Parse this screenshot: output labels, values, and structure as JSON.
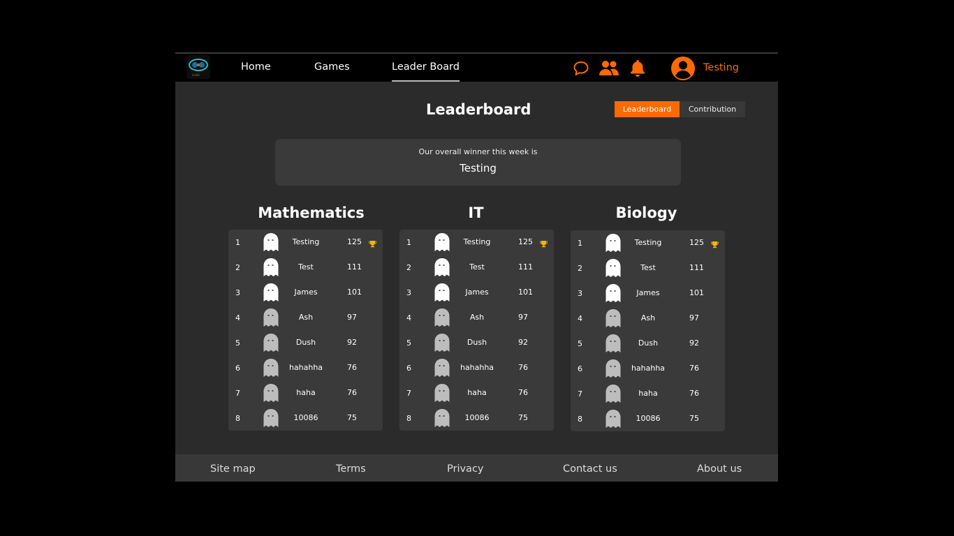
{
  "logo": {
    "text": "Lilaks",
    "icon": "game-logo-icon"
  },
  "nav": {
    "home": "Home",
    "games": "Games",
    "leaderboard": "Leader Board"
  },
  "header_icons": [
    "chat-bubble-icon",
    "friends-icon",
    "bell-icon",
    "user-avatar-icon"
  ],
  "user": {
    "name": "Testing"
  },
  "page": {
    "title": "Leaderboard"
  },
  "tabs": {
    "leaderboard": "Leaderboard",
    "contribution": "Contribution"
  },
  "winner": {
    "label": "Our overall winner this week is",
    "name": "Testing"
  },
  "boards": [
    {
      "subject": "Mathematics",
      "rows": [
        {
          "rank": "1",
          "name": "Testing",
          "score": "125"
        },
        {
          "rank": "2",
          "name": "Test",
          "score": "111"
        },
        {
          "rank": "3",
          "name": "James",
          "score": "101"
        },
        {
          "rank": "4",
          "name": "Ash",
          "score": "97"
        },
        {
          "rank": "5",
          "name": "Dush",
          "score": "92"
        },
        {
          "rank": "6",
          "name": "hahahha",
          "score": "76"
        },
        {
          "rank": "7",
          "name": "haha",
          "score": "76"
        },
        {
          "rank": "8",
          "name": "10086",
          "score": "75"
        }
      ]
    },
    {
      "subject": "IT",
      "rows": [
        {
          "rank": "1",
          "name": "Testing",
          "score": "125"
        },
        {
          "rank": "2",
          "name": "Test",
          "score": "111"
        },
        {
          "rank": "3",
          "name": "James",
          "score": "101"
        },
        {
          "rank": "4",
          "name": "Ash",
          "score": "97"
        },
        {
          "rank": "5",
          "name": "Dush",
          "score": "92"
        },
        {
          "rank": "6",
          "name": "hahahha",
          "score": "76"
        },
        {
          "rank": "7",
          "name": "haha",
          "score": "76"
        },
        {
          "rank": "8",
          "name": "10086",
          "score": "75"
        }
      ]
    },
    {
      "subject": "Biology",
      "rows": [
        {
          "rank": "1",
          "name": "Testing",
          "score": "125"
        },
        {
          "rank": "2",
          "name": "Test",
          "score": "111"
        },
        {
          "rank": "3",
          "name": "James",
          "score": "101"
        },
        {
          "rank": "4",
          "name": "Ash",
          "score": "97"
        },
        {
          "rank": "5",
          "name": "Dush",
          "score": "92"
        },
        {
          "rank": "6",
          "name": "hahahha",
          "score": "76"
        },
        {
          "rank": "7",
          "name": "haha",
          "score": "76"
        },
        {
          "rank": "8",
          "name": "10086",
          "score": "75"
        }
      ]
    }
  ],
  "footer": {
    "site_map": "Site map",
    "terms": "Terms",
    "privacy": "Privacy",
    "contact": "Contact us",
    "about": "About us"
  },
  "colors": {
    "accent": "#ff6a00",
    "background": "#2b2b2b",
    "panel": "#3a3a3a",
    "header": "#000000",
    "trophy": "#f5b800"
  }
}
